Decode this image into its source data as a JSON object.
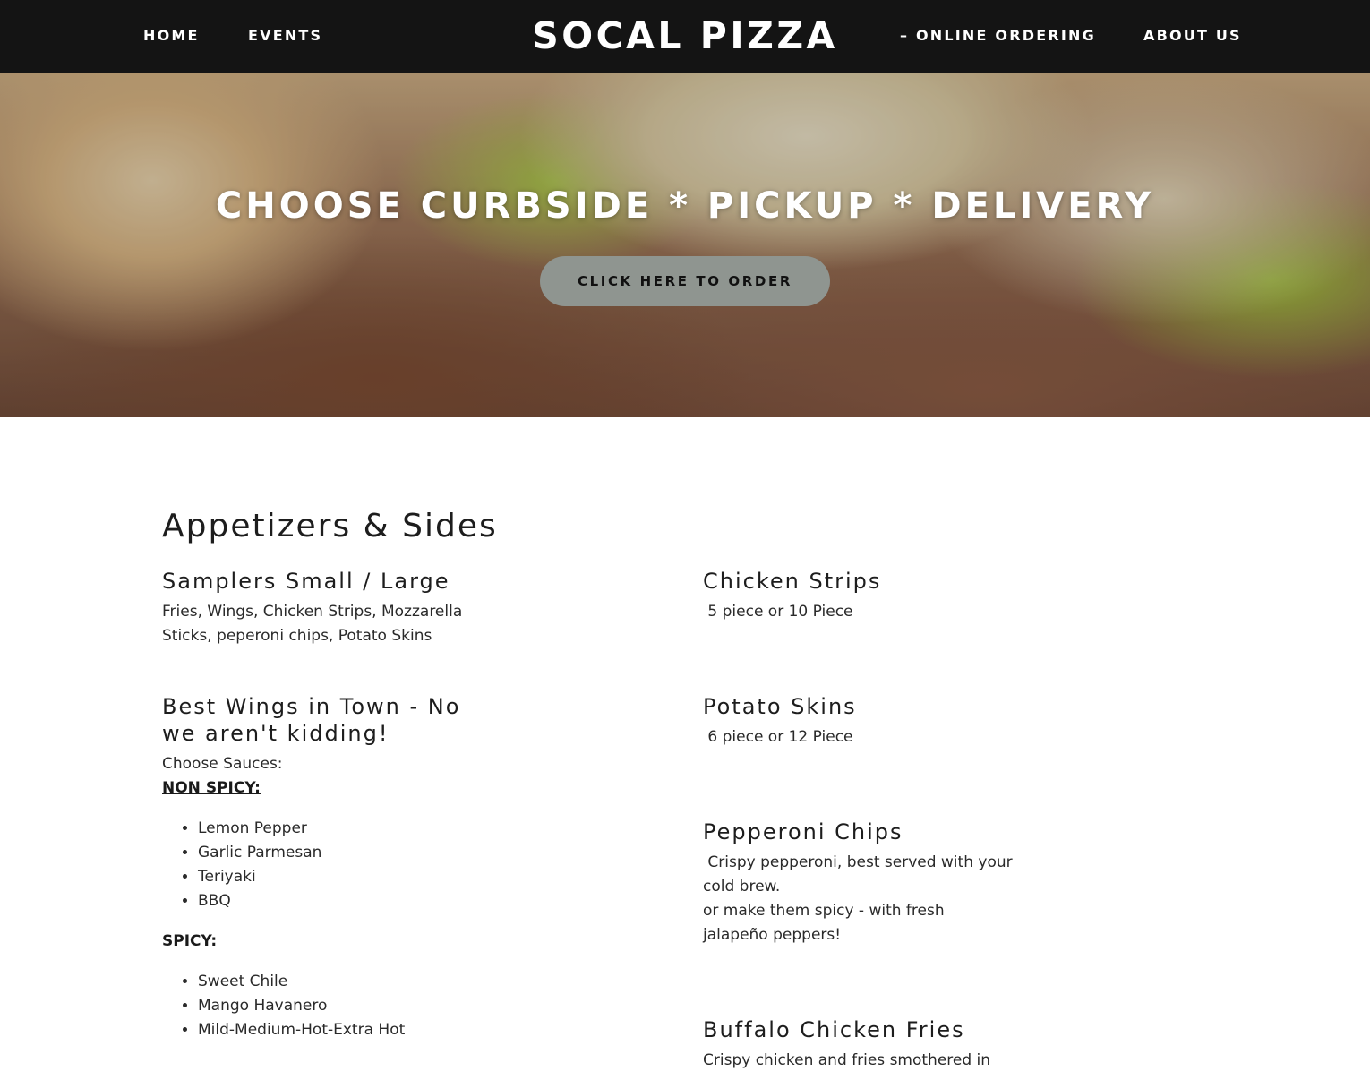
{
  "nav": {
    "home": "HOME",
    "events": "EVENTS",
    "site_title": "SOCAL PIZZA",
    "online_ordering": "– ONLINE ORDERING",
    "about": "ABOUT US"
  },
  "hero": {
    "heading": "CHOOSE CURBSIDE * PICKUP * DELIVERY",
    "button_label": "CLICK HERE TO ORDER"
  },
  "menu": {
    "section_title": "Appetizers & Sides",
    "samplers": {
      "name": "Samplers Small / Large",
      "desc_line1": "Fries, Wings, Chicken Strips, Mozzarella",
      "desc_line2": "Sticks, peperoni chips, Potato Skins"
    },
    "wings": {
      "name_line1": "Best Wings in Town - No",
      "name_line2": "we aren't kidding!",
      "choose": "Choose Sauces:",
      "non_spicy_label": "NON SPICY:",
      "non_spicy": [
        "Lemon Pepper",
        "Garlic Parmesan",
        "Teriyaki",
        "BBQ"
      ],
      "spicy_label": "SPICY:",
      "spicy": [
        "Sweet Chile",
        "Mango Havanero",
        "Mild-Medium-Hot-Extra Hot"
      ]
    },
    "chicken_strips": {
      "name": "Chicken Strips",
      "desc": " 5 piece or 10 Piece"
    },
    "potato_skins": {
      "name": "Potato Skins",
      "desc": " 6 piece or 12 Piece"
    },
    "pepperoni_chips": {
      "name": "Pepperoni Chips",
      "desc_line1": " Crispy pepperoni, best served with your",
      "desc_line2": "cold brew.",
      "desc_line3": "or make them spicy - with fresh",
      "desc_line4": "jalapeño peppers!"
    },
    "buffalo_fries": {
      "name": "Buffalo Chicken Fries",
      "desc_line1": "Crispy chicken and fries smothered in"
    }
  },
  "colors": {
    "nav_bg": "#141414",
    "button_bg": "#8f9590",
    "text": "#1d1d1d"
  }
}
